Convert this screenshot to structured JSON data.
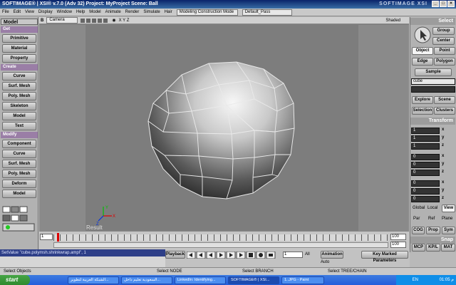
{
  "window": {
    "title": "SOFTIMAGE® | XSI® v.7.0 (Adv 32) Project: MyProject   Scene: Ball",
    "brand": "SOFTIMAGE XSI"
  },
  "menu": {
    "items": [
      "File",
      "Edit",
      "View",
      "Display",
      "Window",
      "Help",
      "Model",
      "Animate",
      "Render",
      "Simulate",
      "Hair"
    ],
    "mode_dropdown": "Modeling Construction Mode",
    "pass_dropdown": "Default_Pass"
  },
  "left_panel": {
    "toolbar_title": "Model",
    "sections": [
      {
        "title": "Get",
        "buttons": [
          "Primitive",
          "Material",
          "Property"
        ]
      },
      {
        "title": "Create",
        "buttons": [
          "Curve",
          "Surf. Mesh",
          "Poly. Mesh",
          "Skeleton",
          "Model",
          "Text"
        ]
      },
      {
        "title": "Modify",
        "buttons": [
          "Component",
          "Curve",
          "Surf. Mesh",
          "Poly. Mesh",
          "Deform",
          "Model"
        ]
      }
    ]
  },
  "viewport": {
    "letter": "B",
    "camera": "Camera",
    "axes_label": "X Y Z",
    "shade_mode": "Shaded",
    "result_label": "Result"
  },
  "right_panel": {
    "select_title": "Select",
    "group_btn": "Group",
    "center_btn": "Center",
    "filter_buttons": [
      "Object",
      "Point",
      "Edge",
      "Polygon"
    ],
    "sample_btn": "Sample",
    "selection_field": "cube",
    "explore_btn": "Explore",
    "scene_btn": "Scene",
    "selection_btn": "Selection",
    "clusters_btn": "Clusters",
    "transform_title": "Transform",
    "scale": {
      "x": "1",
      "y": "1",
      "z": "1"
    },
    "rotate": {
      "x": "0",
      "y": "0",
      "z": "0"
    },
    "translate": {
      "x": "0",
      "y": "0",
      "z": "0"
    },
    "axis_labels": [
      "x",
      "y",
      "z"
    ],
    "ref_buttons": [
      "Global",
      "Local",
      "View",
      "Par",
      "Ref",
      "Plane"
    ],
    "bottom_buttons": [
      "COG",
      "Prop",
      "Sym"
    ],
    "snap_title": "Snap",
    "mcp_buttons": [
      "MCP",
      "KP/L",
      "MAT"
    ]
  },
  "timeline": {
    "start": "1",
    "end": "100",
    "end2": "100",
    "current": "1"
  },
  "playback": {
    "label": "Playback",
    "frame": "1",
    "all": "All",
    "animation": "Animation",
    "auto": "Auto",
    "key_marked": "Key Marked Parameters"
  },
  "cmdline": "SetValue \"cube.polymsh.shrinkwrap.ampl\", 1",
  "status": {
    "left": "Select Objects",
    "l_node": "Select NODE",
    "m_branch": "Select BRANCH",
    "r_tree": "Select TREE/CHAIN"
  },
  "taskbar": {
    "start": "start",
    "tasks": [
      "الشبكة العربية لتطوير...",
      "السعودية تعليم داخل...",
      "LinkedIn: Identifying...",
      "SOFTIMAGE® | XSI...",
      "1..JPG - Paint"
    ],
    "active_index": 3,
    "lang": "EN",
    "clock": "01:05 م"
  }
}
